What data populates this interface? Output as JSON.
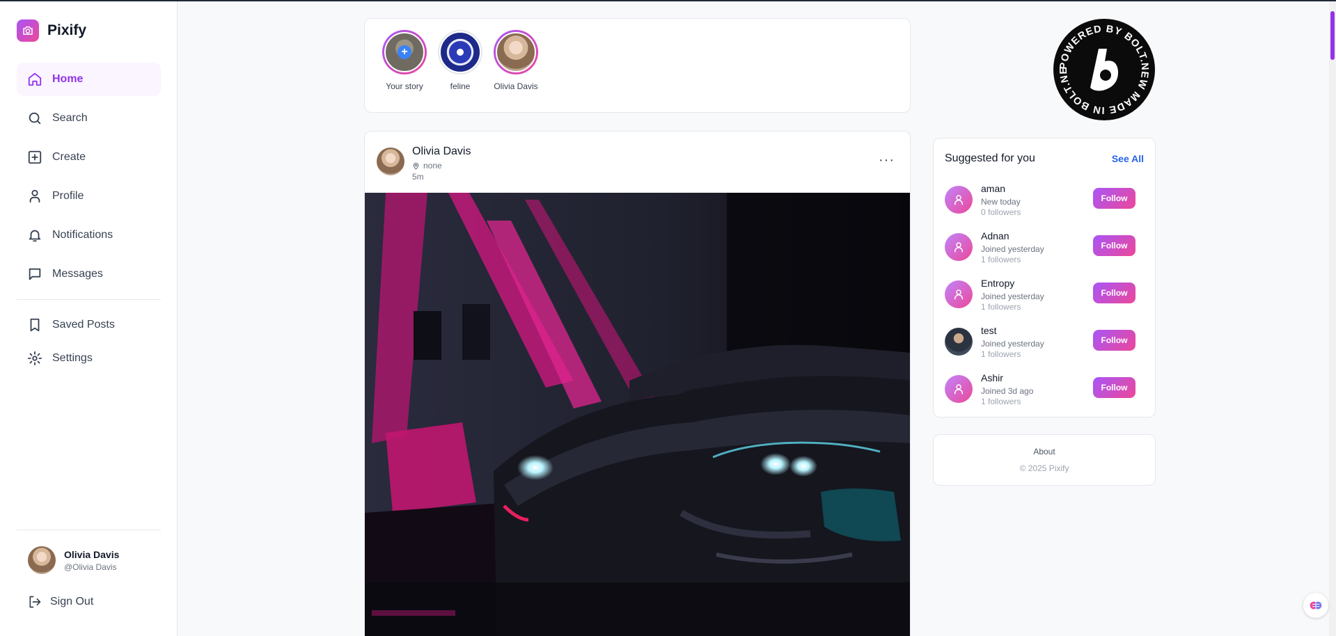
{
  "brand": {
    "name": "Pixify",
    "color_start": "#a855f7",
    "color_end": "#ec4899"
  },
  "nav": {
    "items": [
      {
        "label": "Home",
        "icon": "home-icon",
        "active": true
      },
      {
        "label": "Search",
        "icon": "search-icon"
      },
      {
        "label": "Create",
        "icon": "plus-square-icon"
      },
      {
        "label": "Profile",
        "icon": "user-icon"
      },
      {
        "label": "Notifications",
        "icon": "bell-icon"
      },
      {
        "label": "Messages",
        "icon": "message-icon"
      }
    ],
    "secondary": [
      {
        "label": "Saved Posts",
        "icon": "bookmark-icon"
      },
      {
        "label": "Settings",
        "icon": "gear-icon"
      }
    ]
  },
  "current_user": {
    "name": "Olivia Davis",
    "handle": "@Olivia Davis"
  },
  "sign_out_label": "Sign Out",
  "stories": [
    {
      "label": "Your story"
    },
    {
      "label": "feline"
    },
    {
      "label": "Olivia Davis"
    }
  ],
  "post": {
    "author": "Olivia Davis",
    "location": "none",
    "time": "5m",
    "more": "···"
  },
  "suggestions": {
    "title": "Suggested for you",
    "see_all": "See All",
    "button_label": "Follow",
    "users": [
      {
        "name": "aman",
        "joined": "New today",
        "followers": "0 followers"
      },
      {
        "name": "Adnan",
        "joined": "Joined yesterday",
        "followers": "1 followers"
      },
      {
        "name": "Entropy",
        "joined": "Joined yesterday",
        "followers": "1 followers"
      },
      {
        "name": "test",
        "joined": "Joined yesterday",
        "followers": "1 followers"
      },
      {
        "name": "Ashir",
        "joined": "Joined 3d ago",
        "followers": "1 followers"
      }
    ]
  },
  "footer": {
    "about": "About",
    "copyright": "© 2025 Pixify"
  },
  "badge_text": "POWERED BY BOLT.NEW MADE IN BOLT.NEW ",
  "colors": {
    "accent": "#9333ea",
    "link": "#2563eb"
  }
}
